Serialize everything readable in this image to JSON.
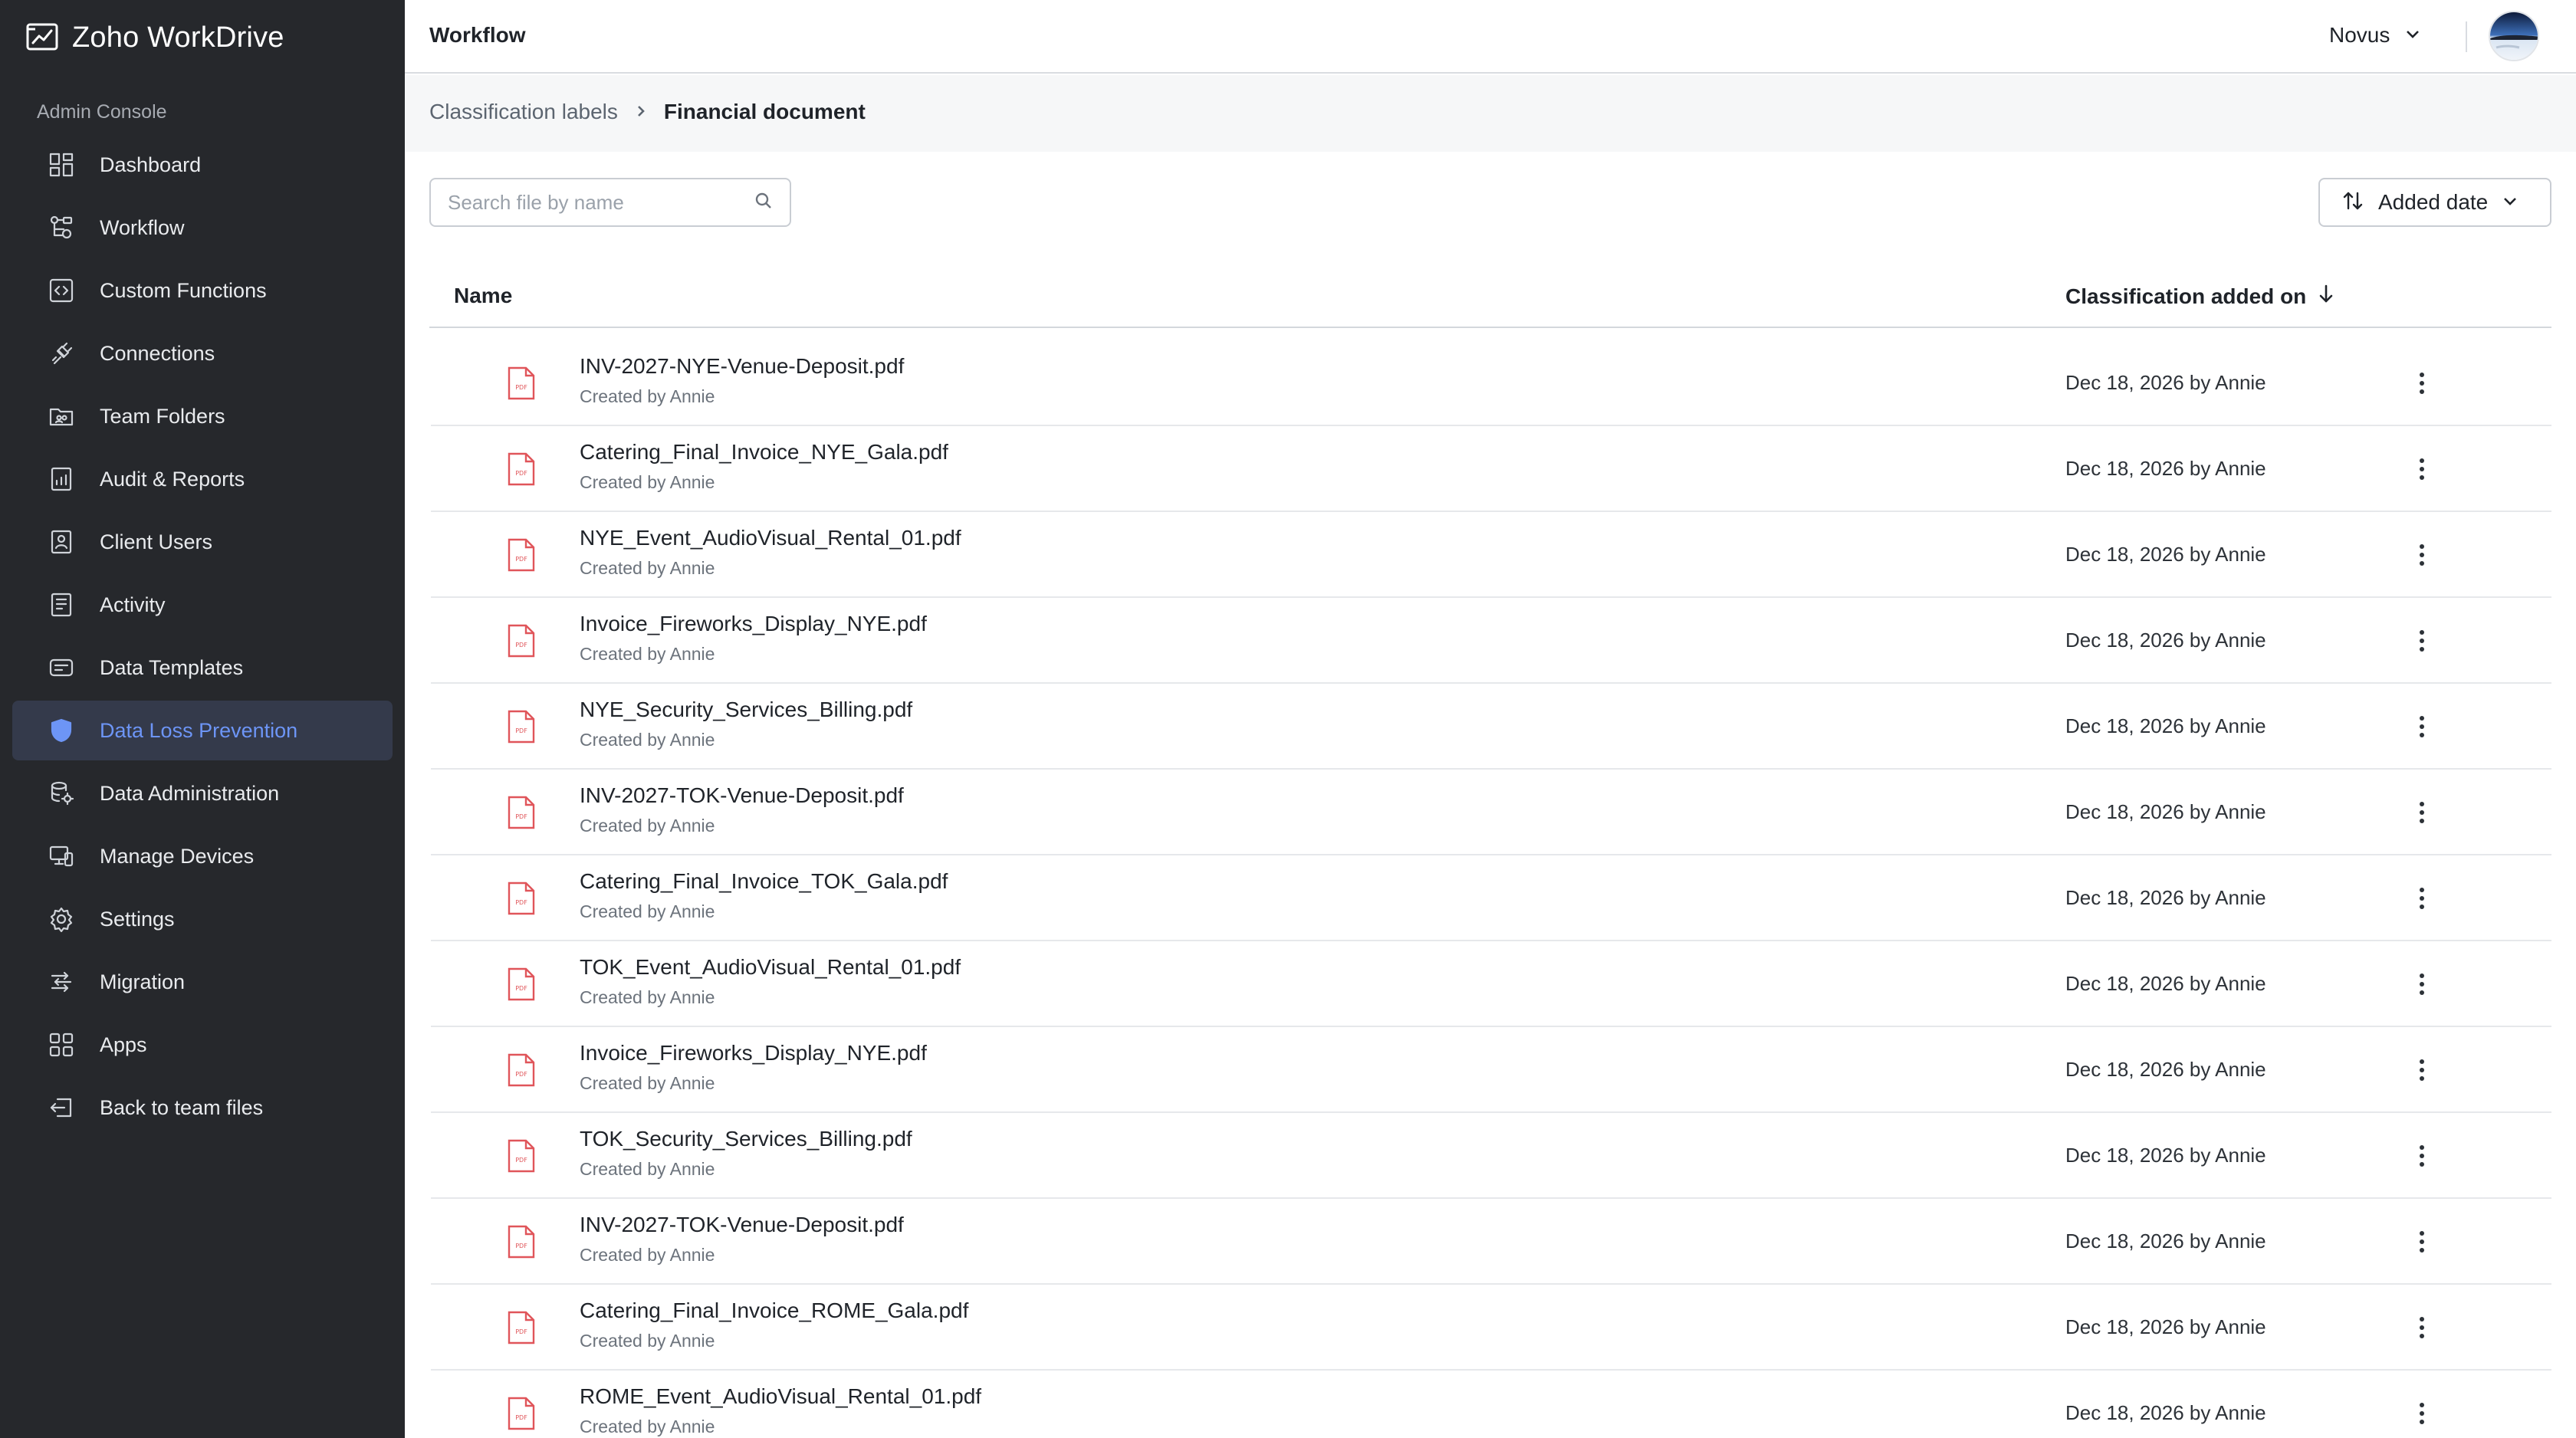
{
  "app": {
    "brand": "Zoho WorkDrive",
    "section_label": "Admin Console"
  },
  "sidebar": {
    "items": [
      {
        "label": "Dashboard",
        "icon": "dashboard-icon",
        "active": false
      },
      {
        "label": "Workflow",
        "icon": "workflow-icon",
        "active": false
      },
      {
        "label": "Custom Functions",
        "icon": "custom-functions-icon",
        "active": false
      },
      {
        "label": "Connections",
        "icon": "connections-icon",
        "active": false
      },
      {
        "label": "Team Folders",
        "icon": "team-folders-icon",
        "active": false
      },
      {
        "label": "Audit & Reports",
        "icon": "audit-reports-icon",
        "active": false
      },
      {
        "label": "Client Users",
        "icon": "client-users-icon",
        "active": false
      },
      {
        "label": "Activity",
        "icon": "activity-icon",
        "active": false
      },
      {
        "label": "Data Templates",
        "icon": "data-templates-icon",
        "active": false
      },
      {
        "label": "Data Loss Prevention",
        "icon": "shield-icon",
        "active": true
      },
      {
        "label": "Data Administration",
        "icon": "data-administration-icon",
        "active": false
      },
      {
        "label": "Manage Devices",
        "icon": "devices-icon",
        "active": false
      },
      {
        "label": "Settings",
        "icon": "gear-icon",
        "active": false
      },
      {
        "label": "Migration",
        "icon": "migration-icon",
        "active": false
      },
      {
        "label": "Apps",
        "icon": "apps-icon",
        "active": false
      },
      {
        "label": "Back to team files",
        "icon": "back-icon",
        "active": false
      }
    ]
  },
  "header": {
    "title": "Workflow",
    "org_name": "Novus"
  },
  "breadcrumb": {
    "parent": "Classification labels",
    "current": "Financial document"
  },
  "toolbar": {
    "search_placeholder": "Search file by name",
    "sort_label": "Added date"
  },
  "table": {
    "col_name": "Name",
    "col_date": "Classification added on",
    "rows": [
      {
        "name": "INV-2027-NYE-Venue-Deposit.pdf",
        "meta": "Created by Annie",
        "date": "Dec 18, 2026 by Annie"
      },
      {
        "name": "Catering_Final_Invoice_NYE_Gala.pdf",
        "meta": "Created by Annie",
        "date": "Dec 18, 2026 by Annie"
      },
      {
        "name": "NYE_Event_AudioVisual_Rental_01.pdf",
        "meta": "Created by Annie",
        "date": "Dec 18, 2026 by Annie"
      },
      {
        "name": "Invoice_Fireworks_Display_NYE.pdf",
        "meta": "Created by Annie",
        "date": "Dec 18, 2026 by Annie"
      },
      {
        "name": "NYE_Security_Services_Billing.pdf",
        "meta": "Created by Annie",
        "date": "Dec 18, 2026 by Annie"
      },
      {
        "name": "INV-2027-TOK-Venue-Deposit.pdf",
        "meta": "Created by Annie",
        "date": "Dec 18, 2026 by Annie"
      },
      {
        "name": "Catering_Final_Invoice_TOK_Gala.pdf",
        "meta": "Created by Annie",
        "date": "Dec 18, 2026 by Annie"
      },
      {
        "name": "TOK_Event_AudioVisual_Rental_01.pdf",
        "meta": "Created by Annie",
        "date": "Dec 18, 2026 by Annie"
      },
      {
        "name": "Invoice_Fireworks_Display_NYE.pdf",
        "meta": "Created by Annie",
        "date": "Dec 18, 2026 by Annie"
      },
      {
        "name": "TOK_Security_Services_Billing.pdf",
        "meta": "Created by Annie",
        "date": "Dec 18, 2026 by Annie"
      },
      {
        "name": "INV-2027-TOK-Venue-Deposit.pdf",
        "meta": "Created by Annie",
        "date": "Dec 18, 2026 by Annie"
      },
      {
        "name": "Catering_Final_Invoice_ROME_Gala.pdf",
        "meta": "Created by Annie",
        "date": "Dec 18, 2026 by Annie"
      },
      {
        "name": "ROME_Event_AudioVisual_Rental_01.pdf",
        "meta": "Created by Annie",
        "date": "Dec 18, 2026 by Annie"
      }
    ]
  },
  "colors": {
    "sidebar_bg": "#26282c",
    "active_bg": "#343a4b",
    "accent": "#6d95f6",
    "pdf_red": "#e0555a"
  },
  "icons": {
    "pdf": "pdf-file-icon",
    "more": "more-vertical-icon",
    "search": "search-icon",
    "sort": "sort-arrows-icon",
    "sort_dir": "arrow-down-icon"
  }
}
